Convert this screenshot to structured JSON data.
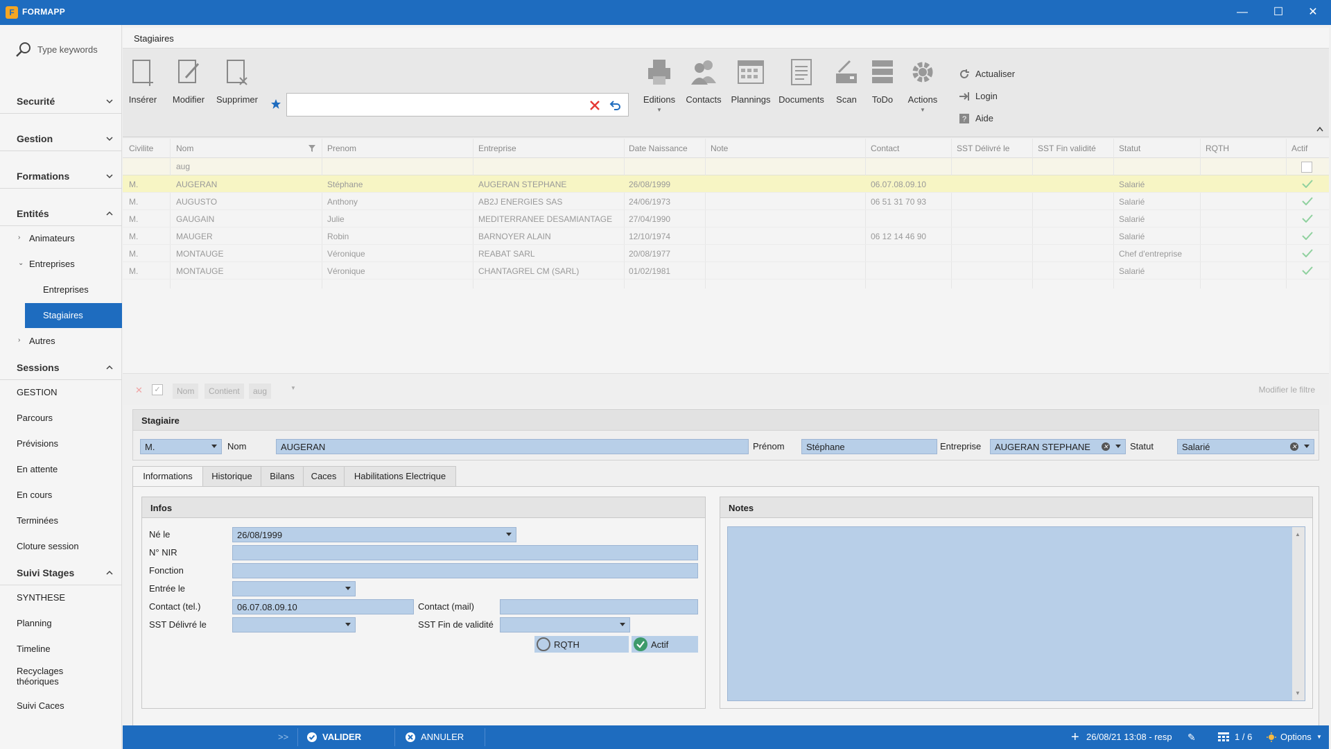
{
  "app": {
    "title": "FORMAPP",
    "logo_letter": "F"
  },
  "window_controls": {
    "minimize": "—",
    "maximize": "☐",
    "close": "✕"
  },
  "sidebar": {
    "search_placeholder": "Type keywords",
    "sections": {
      "securite": "Securité",
      "gestion": "Gestion",
      "formations": "Formations",
      "entites": "Entités",
      "sessions": "Sessions",
      "suivi": "Suivi Stages"
    },
    "entites_items": {
      "animateurs": "Animateurs",
      "entreprises": "Entreprises",
      "entreprises_sub": "Entreprises",
      "stagiaires": "Stagiaires",
      "autres": "Autres"
    },
    "sessions_items": [
      "GESTION",
      "Parcours",
      "Prévisions",
      "En attente",
      "En cours",
      "Terminées",
      "Cloture session"
    ],
    "suivi_items": [
      "SYNTHESE",
      "Planning",
      "Timeline",
      "Recyclages\nthéoriques",
      "Suivi Caces"
    ]
  },
  "page": {
    "title": "Stagiaires"
  },
  "ribbon": {
    "inserer": "Insérer",
    "modifier": "Modifier",
    "supprimer": "Supprimer",
    "editions": "Editions",
    "contacts": "Contacts",
    "plannings": "Plannings",
    "documents": "Documents",
    "scan": "Scan",
    "todo": "ToDo",
    "actions": "Actions",
    "actualiser": "Actualiser",
    "login": "Login",
    "aide": "Aide",
    "search_value": ""
  },
  "grid": {
    "columns": [
      "Civilite",
      "Nom",
      "Prenom",
      "Entreprise",
      "Date Naissance",
      "Note",
      "Contact",
      "SST Délivré le",
      "SST Fin validité",
      "Statut",
      "RQTH",
      "Actif"
    ],
    "filter_value": "aug",
    "rows": [
      {
        "civ": "M.",
        "nom": "AUGERAN",
        "prenom": "Stéphane",
        "entreprise": "AUGERAN STEPHANE",
        "naissance": "26/08/1999",
        "contact": "06.07.08.09.10",
        "statut": "Salarié"
      },
      {
        "civ": "M.",
        "nom": "AUGUSTO",
        "prenom": "Anthony",
        "entreprise": "AB2J ENERGIES SAS",
        "naissance": "24/06/1973",
        "contact": "06 51 31 70 93",
        "statut": "Salarié"
      },
      {
        "civ": "M.",
        "nom": "GAUGAIN",
        "prenom": "Julie",
        "entreprise": "MEDITERRANEE DESAMIANTAGE",
        "naissance": "27/04/1990",
        "contact": "",
        "statut": "Salarié"
      },
      {
        "civ": "M.",
        "nom": "MAUGER",
        "prenom": "Robin",
        "entreprise": "BARNOYER ALAIN",
        "naissance": "12/10/1974",
        "contact": "06 12 14 46 90",
        "statut": "Salarié"
      },
      {
        "civ": "M.",
        "nom": "MONTAUGE",
        "prenom": "Véronique",
        "entreprise": "REABAT SARL",
        "naissance": "20/08/1977",
        "contact": "",
        "statut": "Chef d'entreprise"
      },
      {
        "civ": "M.",
        "nom": "MONTAUGE",
        "prenom": "Véronique",
        "entreprise": "CHANTAGREL CM (SARL)",
        "naissance": "01/02/1981",
        "contact": "",
        "statut": "Salarié"
      }
    ]
  },
  "filterbar": {
    "field": "Nom",
    "op": "Contient",
    "value": "aug",
    "modify": "Modifier le filtre"
  },
  "stagiaire": {
    "title": "Stagiaire",
    "civilite": "M.",
    "nom_label": "Nom",
    "nom": "AUGERAN",
    "prenom_label": "Prénom",
    "prenom": "Stéphane",
    "entreprise_label": "Entreprise",
    "entreprise": "AUGERAN STEPHANE",
    "statut_label": "Statut",
    "statut": "Salarié"
  },
  "tabs": [
    "Informations",
    "Historique",
    "Bilans",
    "Caces",
    "Habilitations Electrique"
  ],
  "infos": {
    "title": "Infos",
    "ne_le_label": "Né le",
    "ne_le": "26/08/1999",
    "nir_label": "N° NIR",
    "nir": "",
    "fonction_label": "Fonction",
    "fonction": "",
    "entree_label": "Entrée le",
    "entree": "",
    "tel_label": "Contact (tel.)",
    "tel": "06.07.08.09.10",
    "mail_label": "Contact (mail)",
    "mail": "",
    "sst_deliv_label": "SST Délivré le",
    "sst_fin_label": "SST Fin de validité",
    "rqth": "RQTH",
    "actif": "Actif"
  },
  "notes": {
    "title": "Notes",
    "content": ""
  },
  "statusbar": {
    "expand": ">>",
    "valider": "VALIDER",
    "annuler": "ANNULER",
    "timestamp": "26/08/21 13:08 - resp",
    "pager": "1 / 6",
    "options": "Options"
  },
  "colors": {
    "accent": "#1e6cbf",
    "field": "#b8cfe8",
    "selected_row": "#f7f5c4",
    "check": "#4caf50",
    "clear_x": "#e53935"
  }
}
